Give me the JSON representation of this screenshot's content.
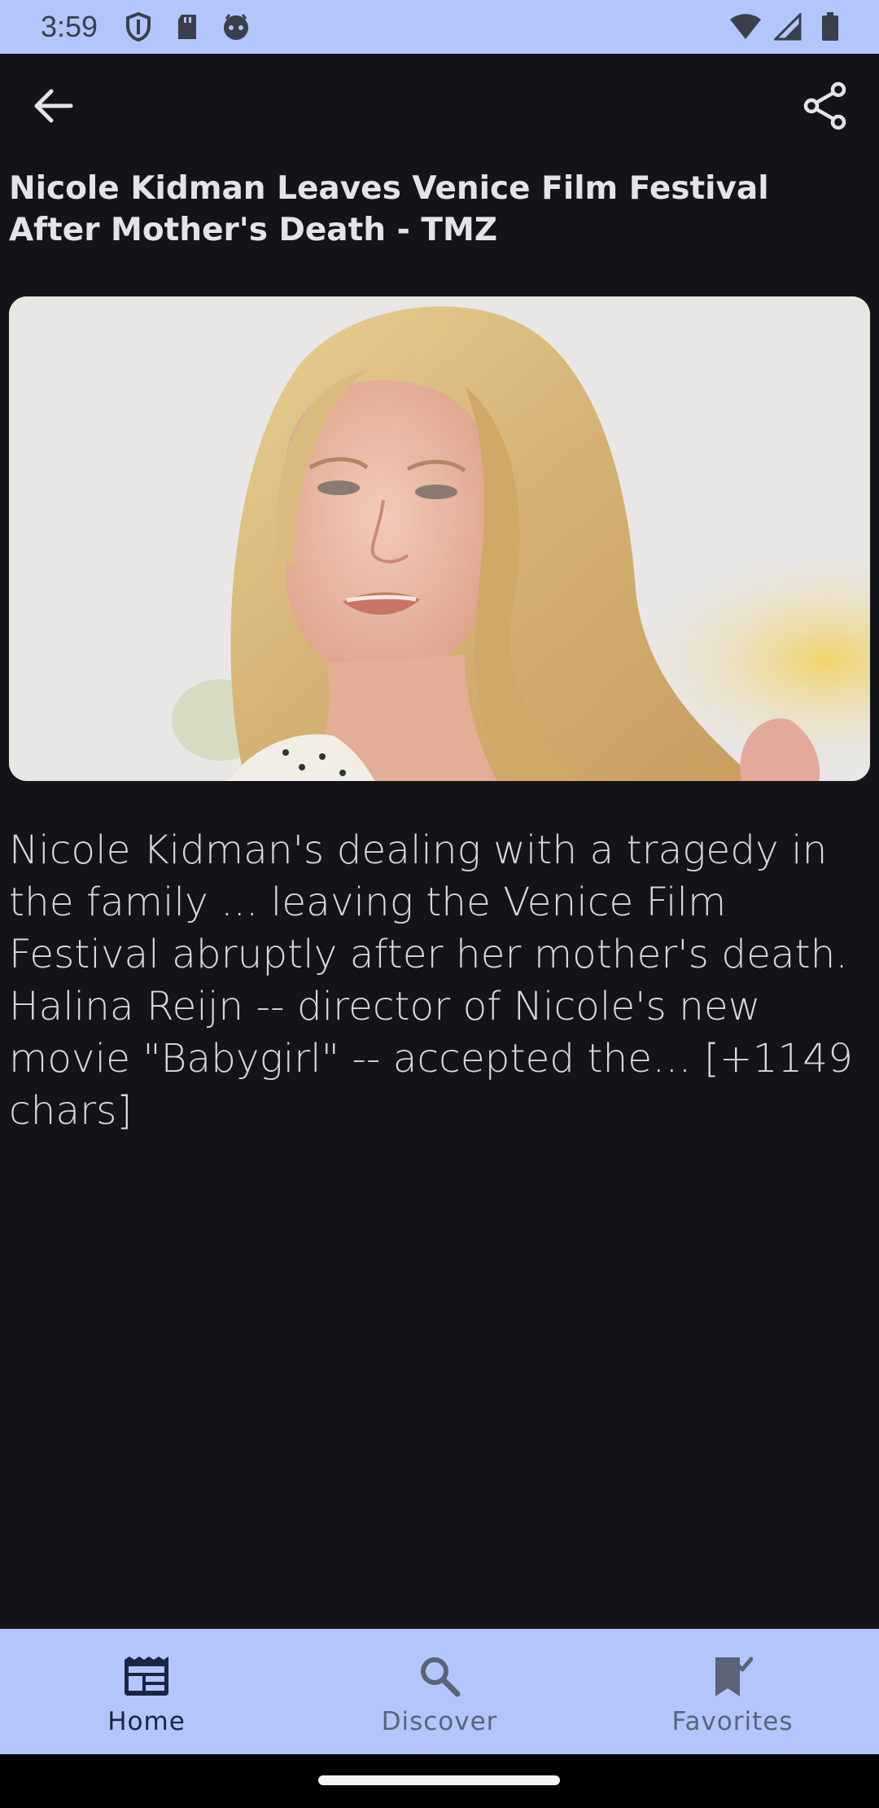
{
  "status_bar": {
    "time": "3:59",
    "left_icons": [
      "shield-icon",
      "sd-card-icon",
      "face-icon"
    ],
    "right_icons": [
      "wifi-icon",
      "signal-icon",
      "battery-icon"
    ],
    "background": "#b3c5fb"
  },
  "app_bar": {
    "back_icon": "arrow-back-icon",
    "share_icon": "share-icon"
  },
  "article": {
    "title": "Nicole Kidman Leaves Venice Film Festival After Mother's Death - TMZ",
    "image_alt": "Photo of Nicole Kidman",
    "body": "Nicole Kidman's dealing with a tragedy in the family ... leaving the Venice Film Festival abruptly after her mother's death.\nHalina Reijn -- director of Nicole's new movie \"Babygirl\" -- accepted the… [+1149 chars]"
  },
  "bottom_nav": {
    "items": [
      {
        "label": "Home",
        "icon": "newspaper-icon",
        "active": true
      },
      {
        "label": "Discover",
        "icon": "search-icon",
        "active": false
      },
      {
        "label": "Favorites",
        "icon": "bookmark-check-icon",
        "active": false
      }
    ],
    "background": "#b3c5fb"
  },
  "colors": {
    "background": "#131418",
    "title_text": "#e4e3ea",
    "body_text": "#d7d7dd"
  }
}
